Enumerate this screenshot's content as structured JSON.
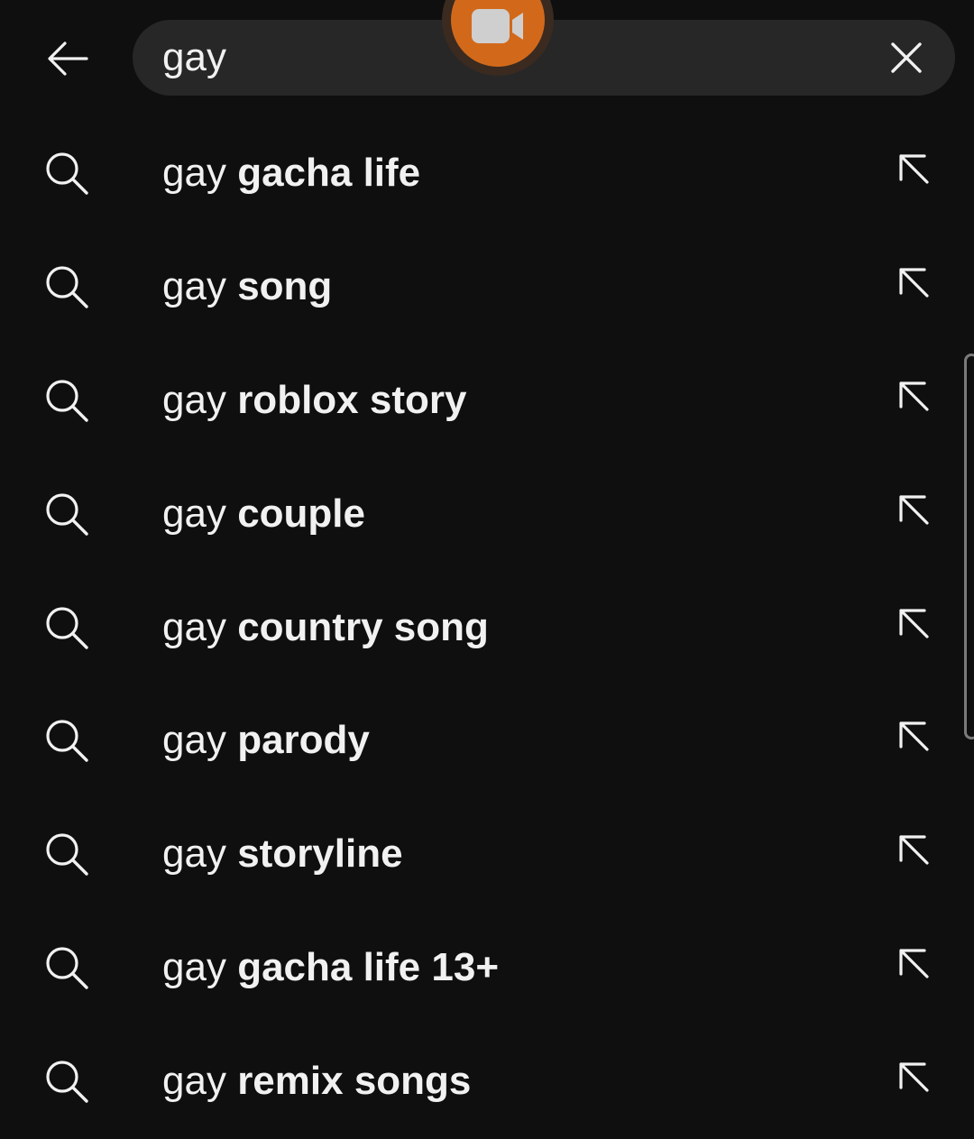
{
  "header": {
    "back_icon": "arrow-left-icon",
    "search": {
      "value": "gay",
      "clear_icon": "close-icon"
    },
    "record_icon": "video-camera-icon",
    "colors": {
      "background": "#0f0f0f",
      "search_box": "#272727",
      "record_button": "#d2691a"
    }
  },
  "suggestions": [
    {
      "prefix": "gay",
      "completion": "gacha life"
    },
    {
      "prefix": "gay",
      "completion": "song"
    },
    {
      "prefix": "gay",
      "completion": "roblox story"
    },
    {
      "prefix": "gay",
      "completion": "couple"
    },
    {
      "prefix": "gay",
      "completion": "country song"
    },
    {
      "prefix": "gay",
      "completion": "parody"
    },
    {
      "prefix": "gay",
      "completion": "storyline"
    },
    {
      "prefix": "gay",
      "completion": "gacha life 13+"
    },
    {
      "prefix": "gay",
      "completion": "remix songs"
    }
  ],
  "suggestion_icons": {
    "leading": "search-icon",
    "trailing": "arrow-up-left-icon"
  }
}
